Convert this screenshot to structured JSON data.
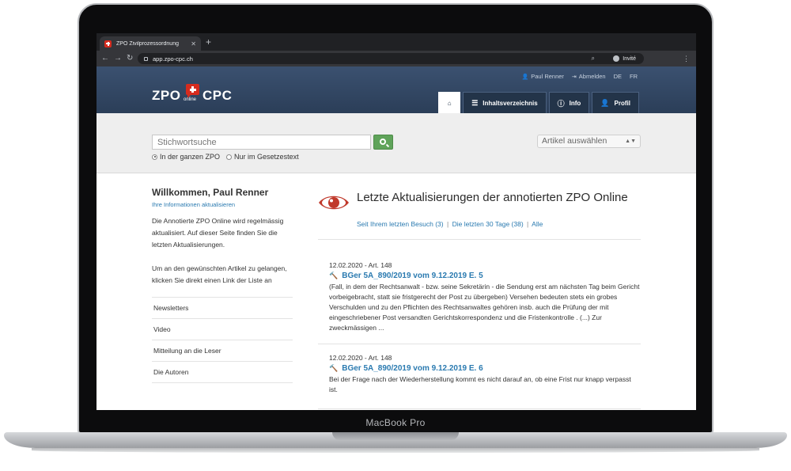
{
  "device": {
    "label": "MacBook Pro"
  },
  "browser": {
    "tab_title": "ZPO Zivilprozessordnung",
    "url": "app.zpo-cpc.ch",
    "profile_label": "Invité"
  },
  "header": {
    "logo": {
      "left": "ZPO",
      "right": "CPC",
      "middle": "online"
    },
    "user_name": "Paul Renner",
    "logout_label": "Abmelden",
    "lang_de": "DE",
    "lang_fr": "FR",
    "tabs": [
      {
        "label": "",
        "icon": "home-icon"
      },
      {
        "label": "Inhaltsverzeichnis",
        "icon": "list-icon"
      },
      {
        "label": "Info",
        "icon": "info-icon"
      },
      {
        "label": "Profil",
        "icon": "user-icon"
      }
    ]
  },
  "search": {
    "placeholder": "Stichwortsuche",
    "scope_options": [
      "In der ganzen ZPO",
      "Nur im Gesetzestext"
    ],
    "selected_scope": 0,
    "article_select": "Artikel auswählen"
  },
  "sidebar": {
    "welcome": "Willkommen, Paul Renner",
    "update_link": "Ihre Informationen aktualisieren",
    "intro": "Die Annotierte ZPO Online wird regelmässig aktualisiert. Auf dieser Seite finden Sie die letzten Aktualisierungen.",
    "intro2": "Um an den gewünschten Artikel zu gelangen, klicken Sie direkt einen Link der Liste an",
    "links": [
      "Newsletters",
      "Video",
      "Mitteilung an die Leser",
      "Die Autoren"
    ]
  },
  "main": {
    "headline": "Letzte Aktualisierungen der annotierten ZPO Online",
    "filters": [
      "Seit Ihrem letzten Besuch (3)",
      "Die letzten 30 Tage (38)",
      "Alle"
    ],
    "filter_separator": "|",
    "entries": [
      {
        "meta": "12.02.2020 - Art. 148",
        "ref": "BGer 5A_890/2019 vom 9.12.2019 E. 5",
        "text": "(Fall, in dem der Rechtsanwalt - bzw. seine Sekretärin - die Sendung erst am nächsten Tag beim Gericht vorbeigebracht, statt sie fristgerecht der Post zu übergeben) Versehen bedeuten stets ein grobes Verschulden und zu den Pflichten des Rechtsanwaltes gehören insb. auch die Prüfung der mit eingeschriebener Post versandten Gerichtskorrespondenz und die Fristenkontrolle . (...) Zur zweckmässigen ..."
      },
      {
        "meta": "12.02.2020 - Art. 148",
        "ref": "BGer 5A_890/2019 vom 9.12.2019 E. 6",
        "text": "Bei der Frage nach der Wiederherstellung kommt es nicht darauf an, ob eine Frist nur knapp verpasst ist."
      }
    ]
  },
  "colors": {
    "header_bg": "#2b3e58",
    "accent_red": "#d52b1e",
    "link_blue": "#2a7ab0",
    "search_green": "#5fa35a"
  }
}
